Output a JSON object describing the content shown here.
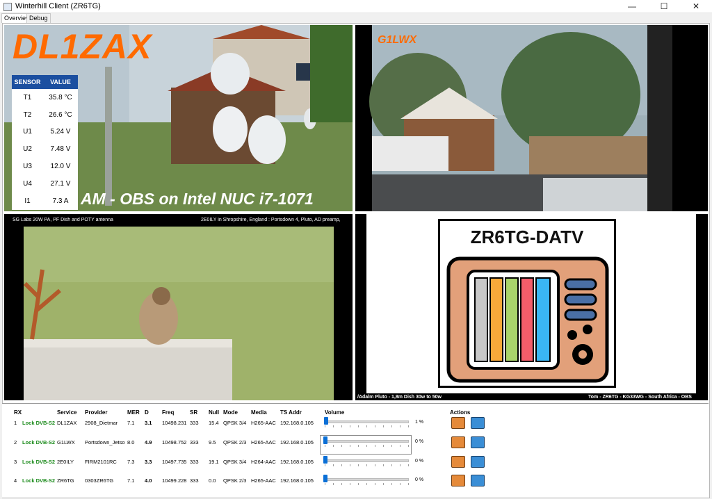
{
  "window": {
    "title": "Winterhill Client (ZR6TG)"
  },
  "tabs": [
    {
      "label": "Overview"
    },
    {
      "label": "Debug"
    }
  ],
  "videos": {
    "v1": {
      "callsign": "DL1ZAX",
      "caption": "AM - OBS on Intel NUC  i7-1071"
    },
    "v2": {
      "callsign": "G1LWX"
    },
    "v3": {
      "left_text": "SG Labs 20W PA,    PF Dish     and     POTY    antenna",
      "right_text": "2E0ILY in Shropshire, England : Portsdown 4,   Pluto,    AD preamp,"
    },
    "v4": {
      "title": "ZR6TG-DATV",
      "left_text": "/Adalm Pluto - 1,8m Dish  30w to  50w",
      "right_text": "Tom - ZR6TG - KG33WG - South Africa - OBS"
    }
  },
  "sensors": {
    "headers": [
      "SENSOR",
      "VALUE"
    ],
    "rows": [
      {
        "name": "T1",
        "value": "35.8 °C"
      },
      {
        "name": "T2",
        "value": "26.6 °C"
      },
      {
        "name": "U1",
        "value": "5.24 V"
      },
      {
        "name": "U2",
        "value": "7.48 V"
      },
      {
        "name": "U3",
        "value": "12.0 V"
      },
      {
        "name": "U4",
        "value": "27.1 V"
      },
      {
        "name": "I1",
        "value": "7.3 A"
      }
    ]
  },
  "table": {
    "headers": [
      "RX",
      "Service",
      "Provider",
      "MER",
      "D",
      "Freq",
      "SR",
      "Null",
      "Mode",
      "Media",
      "TS Addr",
      "Volume",
      "Actions"
    ],
    "rows": [
      {
        "rx": "1",
        "status": "Lock DVB-S2",
        "service": "DL1ZAX",
        "provider": "2908_Dietmar",
        "mer": "7.1",
        "d": "3.1",
        "freq": "10498.231",
        "sr": "333",
        "null": "15.4",
        "mode": "QPSK 3/4",
        "media": "H265-AAC",
        "ts": "192.168.0.105",
        "volume_pct": "1 %",
        "volume": 0.01
      },
      {
        "rx": "2",
        "status": "Lock DVB-S2",
        "service": "G1LWX",
        "provider": "Portsdown_Jetso",
        "mer": "8.0",
        "d": "4.9",
        "freq": "10498.752",
        "sr": "333",
        "null": "9.5",
        "mode": "QPSK 2/3",
        "media": "H265-AAC",
        "ts": "192.168.0.105",
        "volume_pct": "0 %",
        "volume": 0.0
      },
      {
        "rx": "3",
        "status": "Lock DVB-S2",
        "service": "2E0ILY",
        "provider": "FIRM2101RC",
        "mer": "7.3",
        "d": "3.3",
        "freq": "10497.735",
        "sr": "333",
        "null": "19.1",
        "mode": "QPSK 3/4",
        "media": "H264-AAC",
        "ts": "192.168.0.105",
        "volume_pct": "0 %",
        "volume": 0.0
      },
      {
        "rx": "4",
        "status": "Lock DVB-S2",
        "service": "ZR6TG",
        "provider": "0303ZR6TG",
        "mer": "7.1",
        "d": "4.0",
        "freq": "10499.228",
        "sr": "333",
        "null": "0.0",
        "mode": "QPSK 2/3",
        "media": "H265-AAC",
        "ts": "192.168.0.105",
        "volume_pct": "0 %",
        "volume": 0.0
      }
    ]
  },
  "colors": {
    "lock": "#1a8a1a",
    "sensor_header": "#1b4fa0",
    "callsign_orange": "#ff6a00",
    "slider": "#0a6fd6"
  },
  "icons": [
    "tv-icon",
    "camera-icon",
    "minimize-icon",
    "maximize-icon",
    "close-icon"
  ]
}
